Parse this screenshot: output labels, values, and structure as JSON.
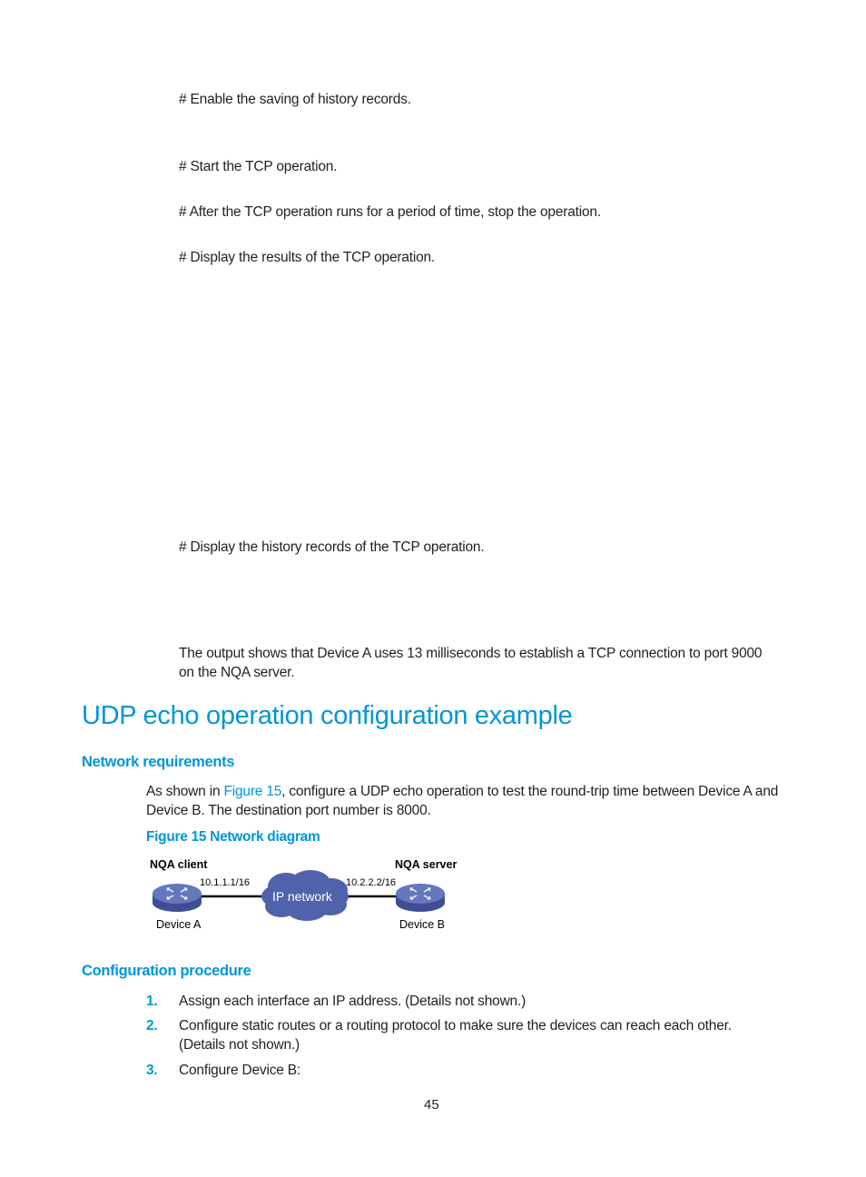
{
  "steps_top": {
    "enable_history": "# Enable the saving of history records.",
    "start_tcp": "# Start the TCP operation.",
    "stop_tcp": "# After the TCP operation runs for a period of time, stop the operation.",
    "display_results": "# Display the results of the TCP operation.",
    "display_history": "# Display the history records of the TCP operation."
  },
  "summary": {
    "line1": "The output shows that Device A uses 13 milliseconds to establish a TCP connection to port 9000",
    "line2": "on the NQA server."
  },
  "section": {
    "title": "UDP echo operation configuration example",
    "network_requirements": {
      "heading": "Network requirements",
      "text_before_link": "As shown in ",
      "link": "Figure 15",
      "text_after_link": ", configure a UDP echo operation to test the round-trip time between Device A and",
      "line2": "Device B. The destination port number is 8000."
    },
    "figure": {
      "caption": "Figure 15 Network diagram",
      "client_role": "NQA client",
      "server_role": "NQA server",
      "client_ip": "10.1.1.1/16",
      "server_ip": "10.2.2.2/16",
      "cloud_label": "IP network",
      "device_a": "Device A",
      "device_b": "Device B",
      "colors": {
        "device": "#5a6bb0",
        "cloud": "#5162ad",
        "link": "#000000"
      }
    },
    "configuration_procedure": {
      "heading": "Configuration procedure",
      "steps": [
        {
          "num": "1.",
          "text": "Assign each interface an IP address. (Details not shown.)"
        },
        {
          "num": "2.",
          "text": "Configure static routes or a routing protocol to make sure the devices can reach each other.",
          "text2": "(Details not shown.)"
        },
        {
          "num": "3.",
          "text": "Configure Device B:"
        }
      ]
    }
  },
  "footer": {
    "page_number": "45"
  },
  "colors": {
    "accent": "#0096d6",
    "text": "#231f20"
  }
}
